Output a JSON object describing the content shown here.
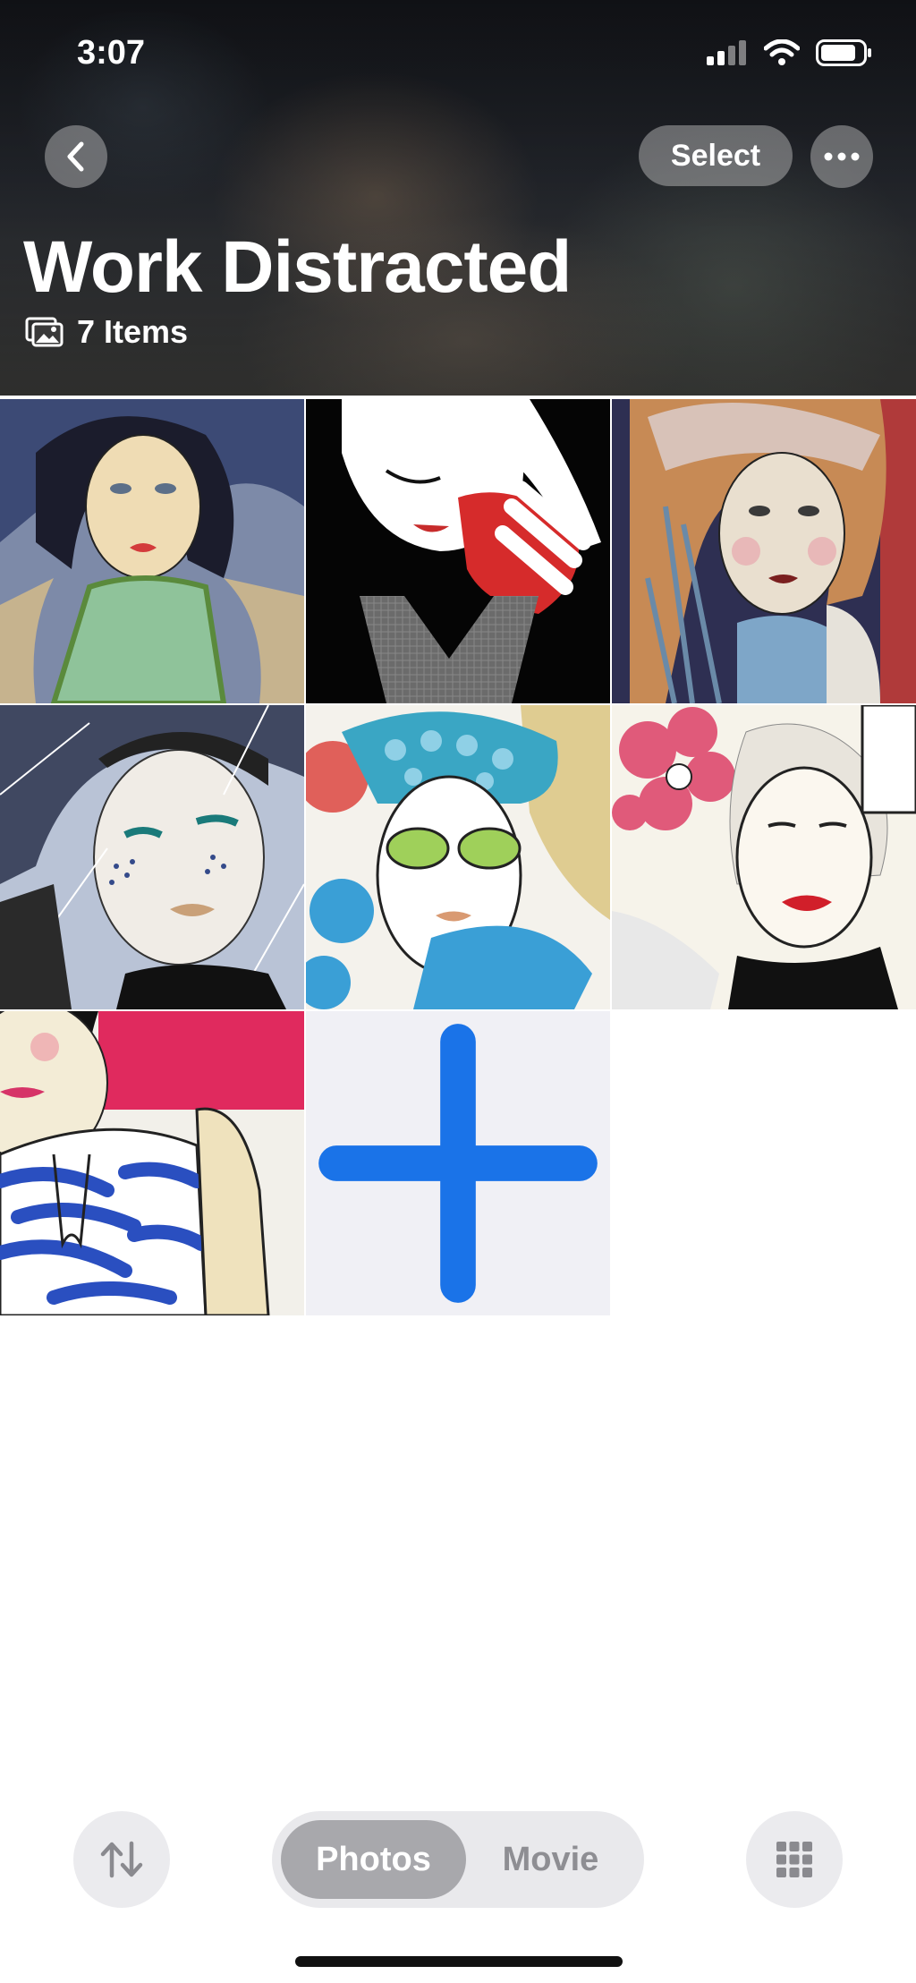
{
  "status_bar": {
    "time": "3:07"
  },
  "header": {
    "select_label": "Select",
    "title": "Work Distracted",
    "item_count": "7 Items"
  },
  "grid": {
    "items": [
      {
        "name": "portrait-dark-curly-hair-green-top"
      },
      {
        "name": "portrait-black-white-red-heart"
      },
      {
        "name": "portrait-colorful-headscarf"
      },
      {
        "name": "portrait-shattered-glass-teal-eyeliner"
      },
      {
        "name": "portrait-green-sunglasses-blue-dots"
      },
      {
        "name": "portrait-red-flower-red-lips"
      },
      {
        "name": "portrait-blue-zebra-top-pink"
      }
    ],
    "add_icon": "plus-icon"
  },
  "toolbar": {
    "sort_icon": "sort-arrows-icon",
    "segments": [
      {
        "label": "Photos",
        "active": true
      },
      {
        "label": "Movie",
        "active": false
      }
    ],
    "grid_icon": "grid-icon"
  },
  "colors": {
    "accent": "#1a73e8",
    "segment_active": "#a8a8ac",
    "add_tile_bg": "#f0f0f5"
  }
}
